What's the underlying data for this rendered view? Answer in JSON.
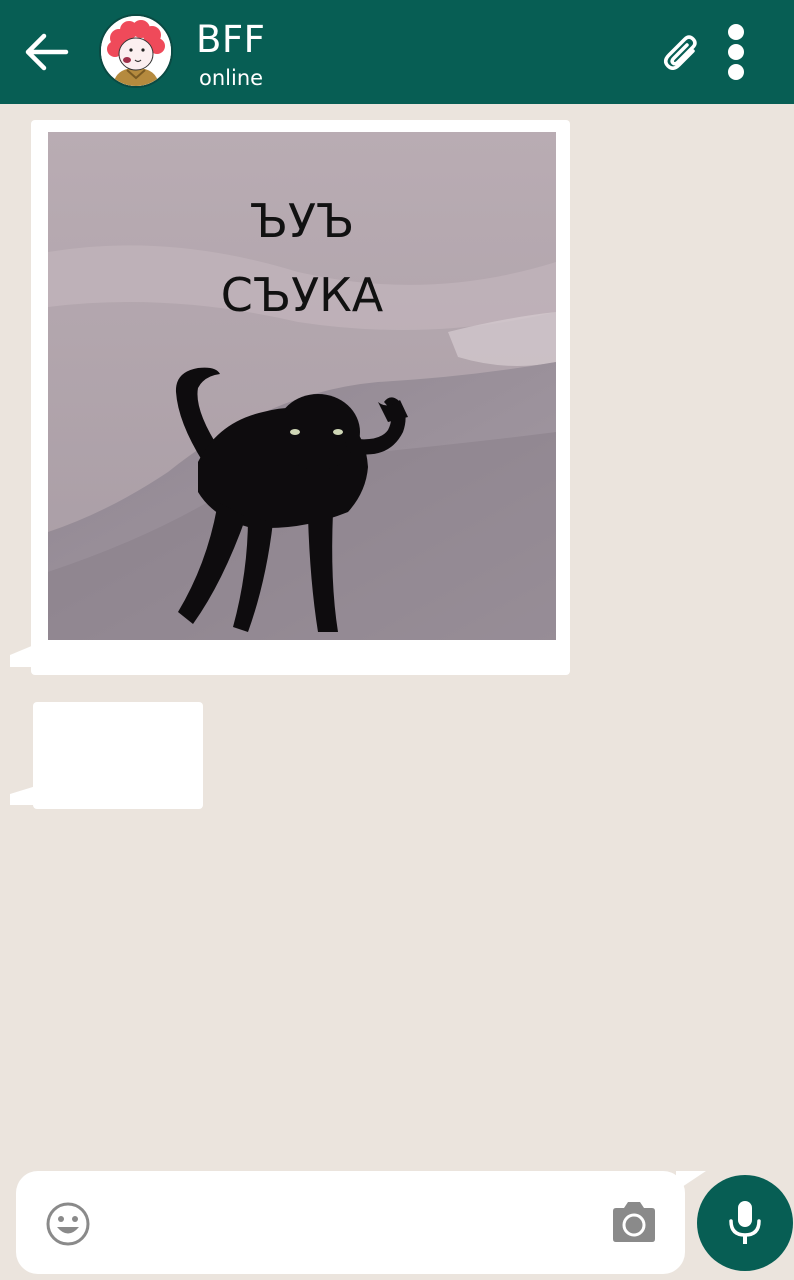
{
  "header": {
    "contact_name": "BFF",
    "status": "online",
    "back_icon": "arrow-left-icon",
    "attach_icon": "paperclip-icon",
    "menu_icon": "more-vertical-icon",
    "background_color": "#075e54"
  },
  "messages": [
    {
      "type": "image",
      "direction": "incoming",
      "image_caption_lines": [
        "ЪУЪ",
        "СЪУКА"
      ]
    },
    {
      "type": "text",
      "direction": "incoming",
      "text": ""
    }
  ],
  "composer": {
    "emoji_icon": "smiley-icon",
    "camera_icon": "camera-icon",
    "mic_icon": "microphone-icon",
    "input_value": "",
    "placeholder": ""
  },
  "colors": {
    "chat_background": "#ebe4dd",
    "bubble": "#ffffff",
    "accent": "#075e54"
  }
}
